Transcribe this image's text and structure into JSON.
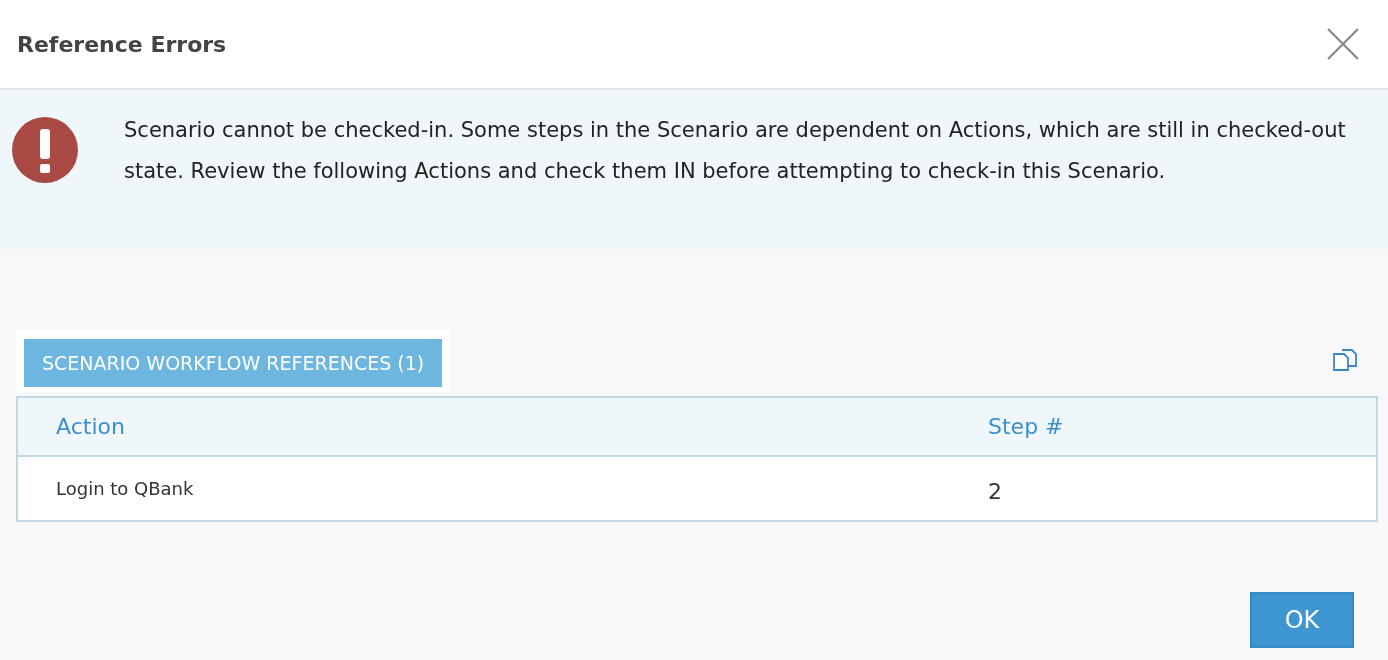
{
  "dialog": {
    "title": "Reference Errors"
  },
  "alert": {
    "message": "Scenario cannot be checked-in. Some steps in the Scenario are dependent on Actions, which are still in checked-out state. Review the following Actions and check them IN before attempting to check-in this Scenario."
  },
  "tabs": [
    {
      "label": "SCENARIO WORKFLOW REFERENCES (1)",
      "selected": true
    }
  ],
  "table": {
    "columns": [
      "Action",
      "Step #"
    ],
    "rows": [
      [
        "Login to QBank",
        "2"
      ]
    ]
  },
  "buttons": [
    "OK"
  ]
}
